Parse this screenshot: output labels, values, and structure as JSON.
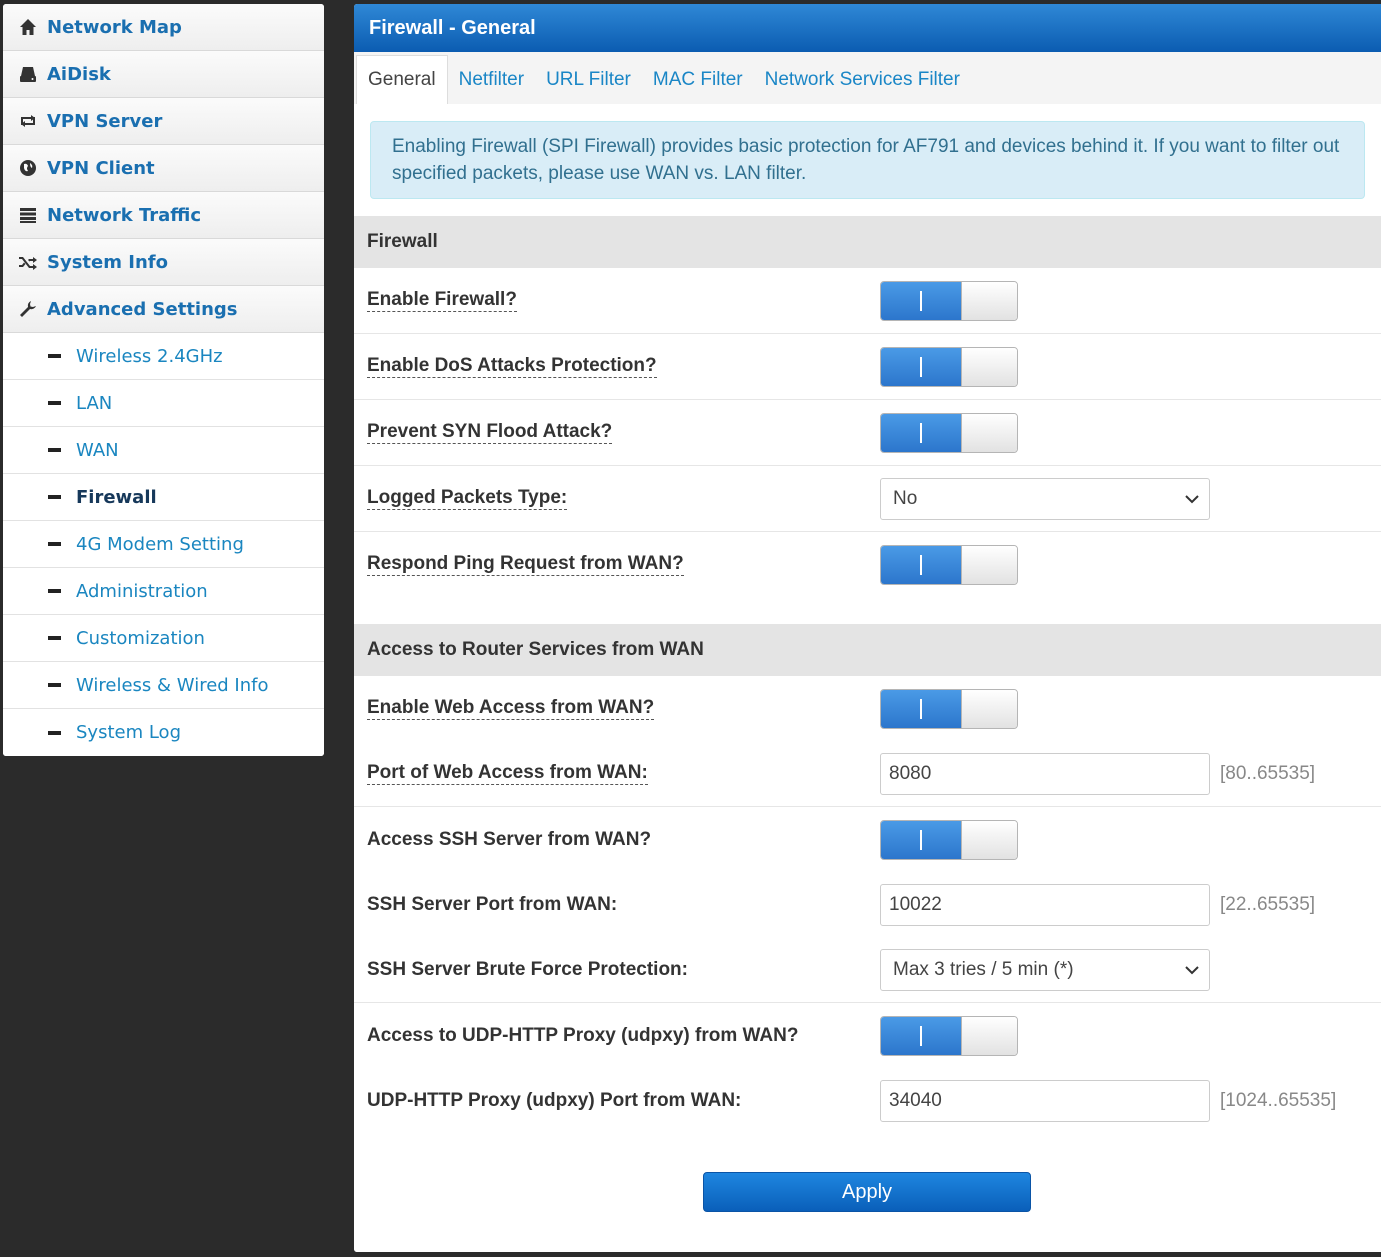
{
  "sidebar": {
    "items": [
      {
        "label": "Network Map",
        "icon": "home-icon"
      },
      {
        "label": "AiDisk",
        "icon": "hdd-icon"
      },
      {
        "label": "VPN Server",
        "icon": "retweet-icon"
      },
      {
        "label": "VPN Client",
        "icon": "globe-icon"
      },
      {
        "label": "Network Traffic",
        "icon": "list-icon"
      },
      {
        "label": "System Info",
        "icon": "random-icon"
      },
      {
        "label": "Advanced Settings",
        "icon": "wrench-icon"
      }
    ],
    "subitems": [
      {
        "label": "Wireless 2.4GHz"
      },
      {
        "label": "LAN"
      },
      {
        "label": "WAN"
      },
      {
        "label": "Firewall"
      },
      {
        "label": "4G Modem Setting"
      },
      {
        "label": "Administration"
      },
      {
        "label": "Customization"
      },
      {
        "label": "Wireless & Wired Info"
      },
      {
        "label": "System Log"
      }
    ],
    "active_subitem": "Firewall"
  },
  "main": {
    "title": "Firewall - General",
    "tabs": [
      {
        "label": "General"
      },
      {
        "label": "Netfilter"
      },
      {
        "label": "URL Filter"
      },
      {
        "label": "MAC Filter"
      },
      {
        "label": "Network Services Filter"
      }
    ],
    "active_tab": "General",
    "alert": "Enabling Firewall (SPI Firewall) provides basic protection for AF791 and devices behind it. If you want to filter out specified packets, please use WAN vs. LAN filter."
  },
  "firewall": {
    "heading": "Firewall",
    "enable_firewall": {
      "label": "Enable Firewall?",
      "value": "on"
    },
    "dos_protection": {
      "label": "Enable DoS Attacks Protection?",
      "value": "on"
    },
    "syn_flood": {
      "label": "Prevent SYN Flood Attack?",
      "value": "on"
    },
    "logged_packets": {
      "label": "Logged Packets Type:",
      "value": "No"
    },
    "respond_ping": {
      "label": "Respond Ping Request from WAN?",
      "value": "on"
    }
  },
  "wan_access": {
    "heading": "Access to Router Services from WAN",
    "web_access": {
      "label": "Enable Web Access from WAN?",
      "value": "on"
    },
    "web_port": {
      "label": "Port of Web Access from WAN:",
      "value": "8080",
      "range": "[80..65535]"
    },
    "ssh_access": {
      "label": "Access SSH Server from WAN?",
      "value": "on"
    },
    "ssh_port": {
      "label": "SSH Server Port from WAN:",
      "value": "10022",
      "range": "[22..65535]"
    },
    "ssh_brute": {
      "label": "SSH Server Brute Force Protection:",
      "value": "Max 3 tries / 5 min (*)"
    },
    "udpxy_access": {
      "label": "Access to UDP-HTTP Proxy (udpxy) from WAN?",
      "value": "on"
    },
    "udpxy_port": {
      "label": "UDP-HTTP Proxy (udpxy) Port from WAN:",
      "value": "34040",
      "range": "[1024..65535]"
    }
  },
  "apply_label": "Apply",
  "colors": {
    "link": "#1a86c0",
    "title_bar": "#0b5cb1",
    "toggle_on": "#2c76cc",
    "alert_bg": "#d9edf7"
  }
}
